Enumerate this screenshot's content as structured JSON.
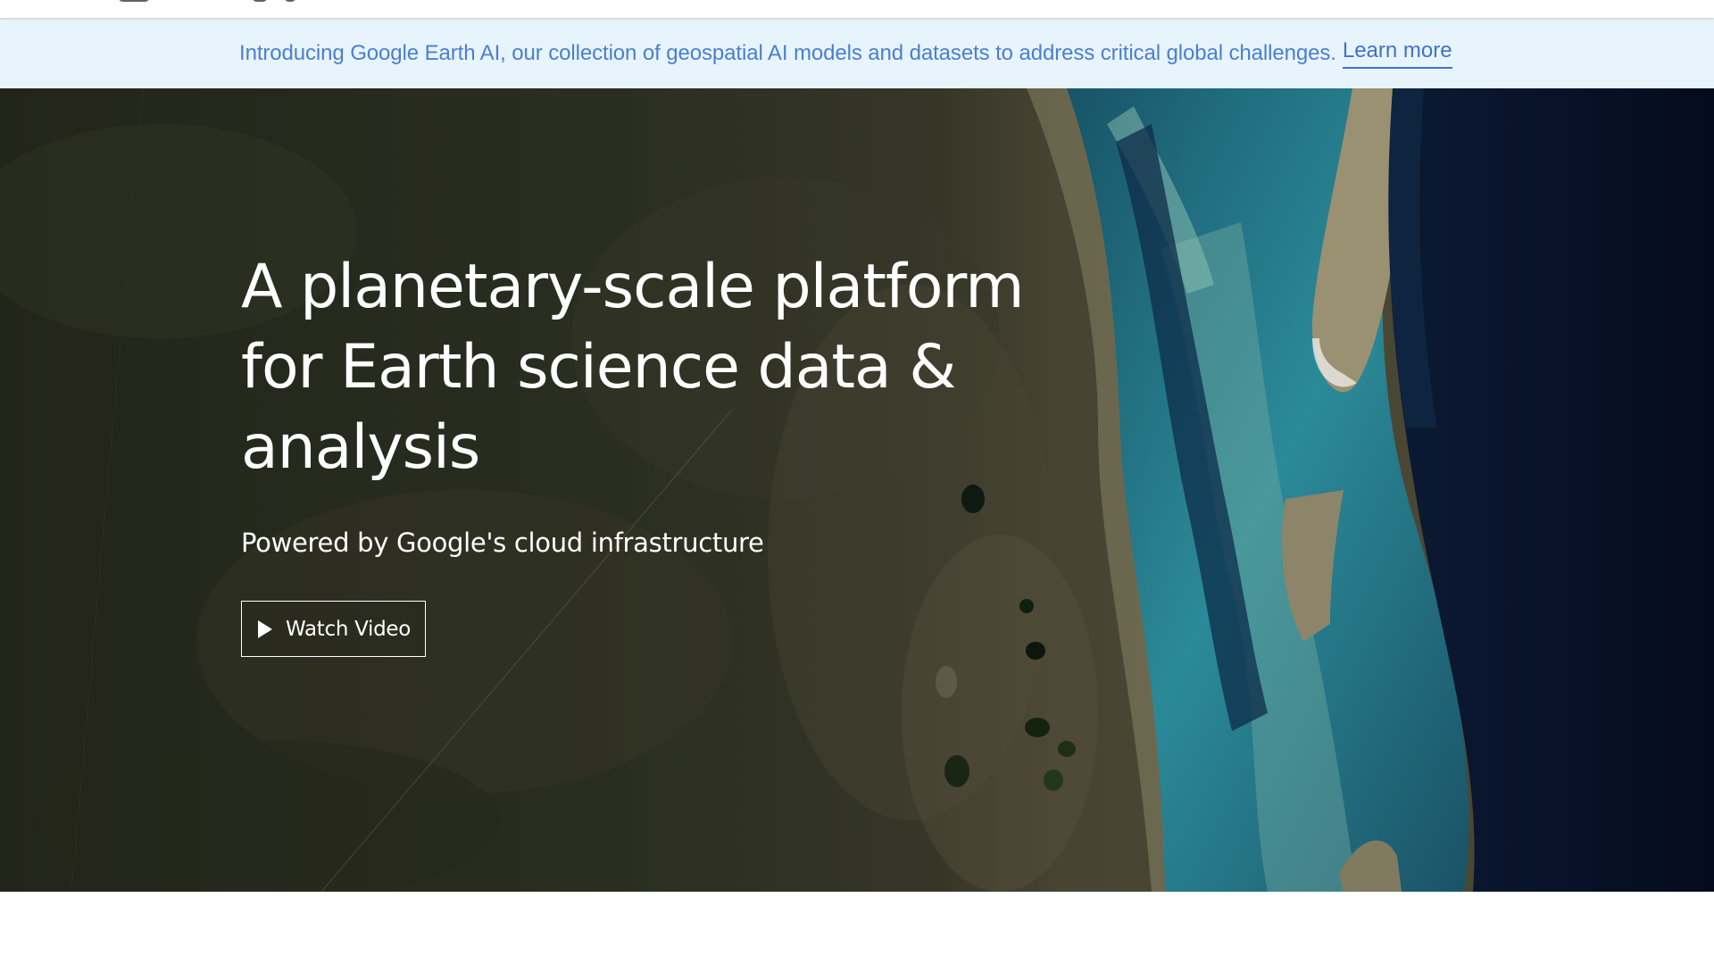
{
  "banner": {
    "text": "Introducing Google Earth AI, our collection of geospatial AI models and datasets to address critical global challenges.",
    "link_label": "Learn more"
  },
  "hero": {
    "title": "A planetary-scale platform for Earth science data & analysis",
    "subtitle": "Powered by Google's cloud infrastructure",
    "button_label": "Watch Video",
    "button_icon": "play-icon",
    "background_image": "satellite-coastline-image"
  },
  "colors": {
    "banner_background": "#e8f4fc",
    "banner_text": "#4a7fd1",
    "hero_text": "#ffffff",
    "ocean_deep": "#07122a",
    "lagoon_teal": "#1f6f82",
    "land_green": "#2f3526"
  }
}
